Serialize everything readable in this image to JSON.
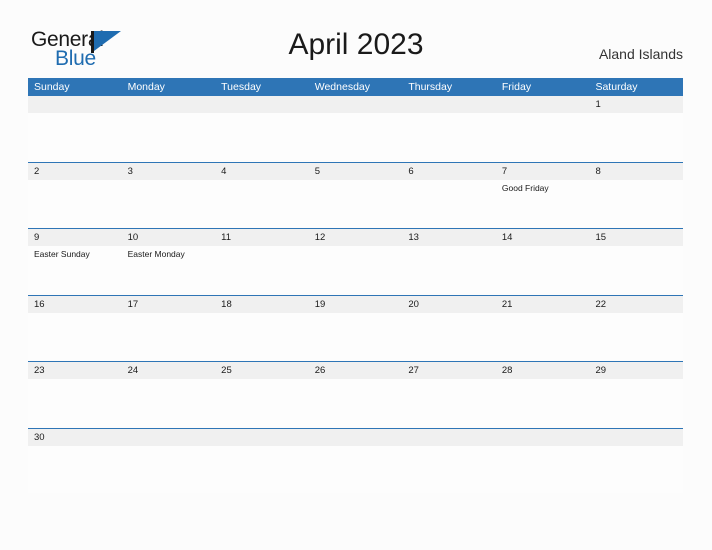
{
  "brand": {
    "name_part_one": "General",
    "name_part_two": "Blue",
    "flag_icon": "flag-triangle-icon",
    "primary_color": "#1f6cb0"
  },
  "header": {
    "title": "April 2023",
    "region": "Aland Islands"
  },
  "calendar": {
    "header_color": "#2e75b6",
    "band_color": "#f0f0f0",
    "day_names": [
      "Sunday",
      "Monday",
      "Tuesday",
      "Wednesday",
      "Thursday",
      "Friday",
      "Saturday"
    ],
    "weeks": [
      {
        "dates": [
          "",
          "",
          "",
          "",
          "",
          "",
          "1"
        ],
        "events": [
          "",
          "",
          "",
          "",
          "",
          "",
          ""
        ]
      },
      {
        "dates": [
          "2",
          "3",
          "4",
          "5",
          "6",
          "7",
          "8"
        ],
        "events": [
          "",
          "",
          "",
          "",
          "",
          "Good Friday",
          ""
        ]
      },
      {
        "dates": [
          "9",
          "10",
          "11",
          "12",
          "13",
          "14",
          "15"
        ],
        "events": [
          "Easter Sunday",
          "Easter Monday",
          "",
          "",
          "",
          "",
          ""
        ]
      },
      {
        "dates": [
          "16",
          "17",
          "18",
          "19",
          "20",
          "21",
          "22"
        ],
        "events": [
          "",
          "",
          "",
          "",
          "",
          "",
          ""
        ]
      },
      {
        "dates": [
          "23",
          "24",
          "25",
          "26",
          "27",
          "28",
          "29"
        ],
        "events": [
          "",
          "",
          "",
          "",
          "",
          "",
          ""
        ]
      },
      {
        "dates": [
          "30",
          "",
          "",
          "",
          "",
          "",
          ""
        ],
        "events": [
          "",
          "",
          "",
          "",
          "",
          "",
          ""
        ]
      }
    ]
  }
}
